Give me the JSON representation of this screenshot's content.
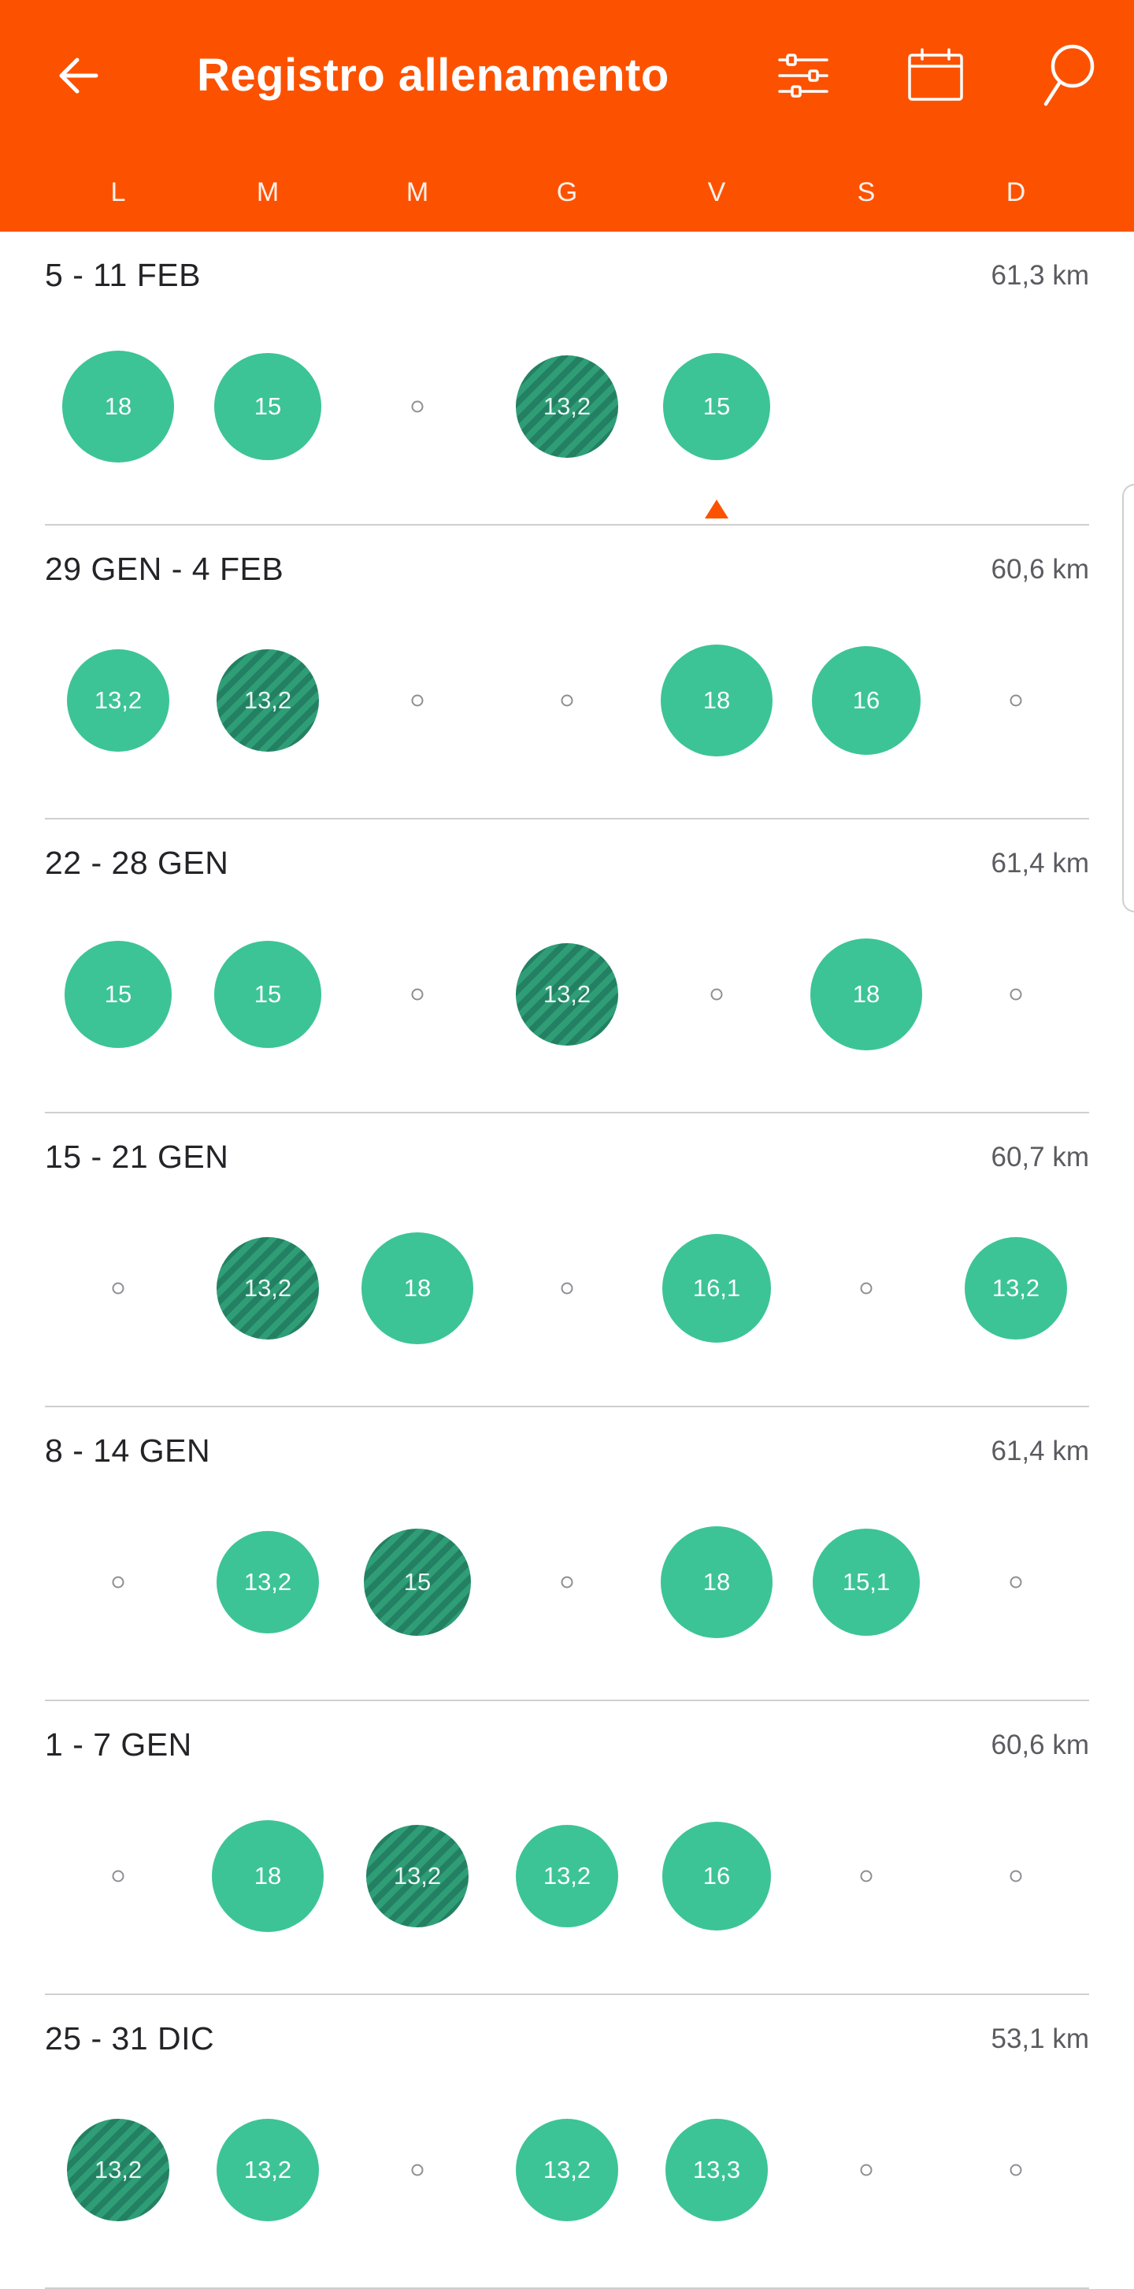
{
  "header": {
    "title": "Registro allenamento",
    "back_icon": "arrow-left-icon",
    "filter_icon": "sliders-icon",
    "calendar_icon": "calendar-icon",
    "search_icon": "search-icon",
    "background": "#fc5200"
  },
  "days": [
    "L",
    "M",
    "M",
    "G",
    "V",
    "S",
    "D"
  ],
  "colors": {
    "activity": "#3cc496",
    "activity_hatched": "#2f9e77",
    "accent": "#fc5200"
  },
  "weeks": [
    {
      "range": "5 - 11 FEB",
      "distance": "61,3 km",
      "current_day_marker": 4,
      "days": [
        {
          "v": "18",
          "hatch": false,
          "size": 142
        },
        {
          "v": "15",
          "hatch": false,
          "size": 136
        },
        {
          "v": null
        },
        {
          "v": "13,2",
          "hatch": true,
          "size": 130
        },
        {
          "v": "15",
          "hatch": false,
          "size": 136
        },
        {
          "v": ""
        },
        {
          "v": ""
        }
      ]
    },
    {
      "range": "29 GEN - 4 FEB",
      "distance": "60,6 km",
      "days": [
        {
          "v": "13,2",
          "hatch": false,
          "size": 130
        },
        {
          "v": "13,2",
          "hatch": true,
          "size": 130
        },
        {
          "v": null
        },
        {
          "v": null
        },
        {
          "v": "18",
          "hatch": false,
          "size": 142
        },
        {
          "v": "16",
          "hatch": false,
          "size": 138
        },
        {
          "v": null
        }
      ]
    },
    {
      "range": "22 - 28 GEN",
      "distance": "61,4 km",
      "days": [
        {
          "v": "15",
          "hatch": false,
          "size": 136
        },
        {
          "v": "15",
          "hatch": false,
          "size": 136
        },
        {
          "v": null
        },
        {
          "v": "13,2",
          "hatch": true,
          "size": 130
        },
        {
          "v": null
        },
        {
          "v": "18",
          "hatch": false,
          "size": 142
        },
        {
          "v": null
        }
      ]
    },
    {
      "range": "15 - 21 GEN",
      "distance": "60,7 km",
      "days": [
        {
          "v": null
        },
        {
          "v": "13,2",
          "hatch": true,
          "size": 130
        },
        {
          "v": "18",
          "hatch": false,
          "size": 142
        },
        {
          "v": null
        },
        {
          "v": "16,1",
          "hatch": false,
          "size": 138
        },
        {
          "v": null
        },
        {
          "v": "13,2",
          "hatch": false,
          "size": 130
        }
      ]
    },
    {
      "range": "8 - 14 GEN",
      "distance": "61,4 km",
      "days": [
        {
          "v": null
        },
        {
          "v": "13,2",
          "hatch": false,
          "size": 130
        },
        {
          "v": "15",
          "hatch": true,
          "size": 136
        },
        {
          "v": null
        },
        {
          "v": "18",
          "hatch": false,
          "size": 142
        },
        {
          "v": "15,1",
          "hatch": false,
          "size": 136
        },
        {
          "v": null
        }
      ]
    },
    {
      "range": "1 - 7 GEN",
      "distance": "60,6 km",
      "days": [
        {
          "v": null
        },
        {
          "v": "18",
          "hatch": false,
          "size": 142
        },
        {
          "v": "13,2",
          "hatch": true,
          "size": 130
        },
        {
          "v": "13,2",
          "hatch": false,
          "size": 130
        },
        {
          "v": "16",
          "hatch": false,
          "size": 138
        },
        {
          "v": null
        },
        {
          "v": null
        }
      ]
    },
    {
      "range": "25 - 31 DIC",
      "distance": "53,1 km",
      "days": [
        {
          "v": "13,2",
          "hatch": true,
          "size": 130
        },
        {
          "v": "13,2",
          "hatch": false,
          "size": 130
        },
        {
          "v": null
        },
        {
          "v": "13,2",
          "hatch": false,
          "size": 130
        },
        {
          "v": "13,3",
          "hatch": false,
          "size": 130
        },
        {
          "v": null
        },
        {
          "v": null
        }
      ]
    }
  ]
}
